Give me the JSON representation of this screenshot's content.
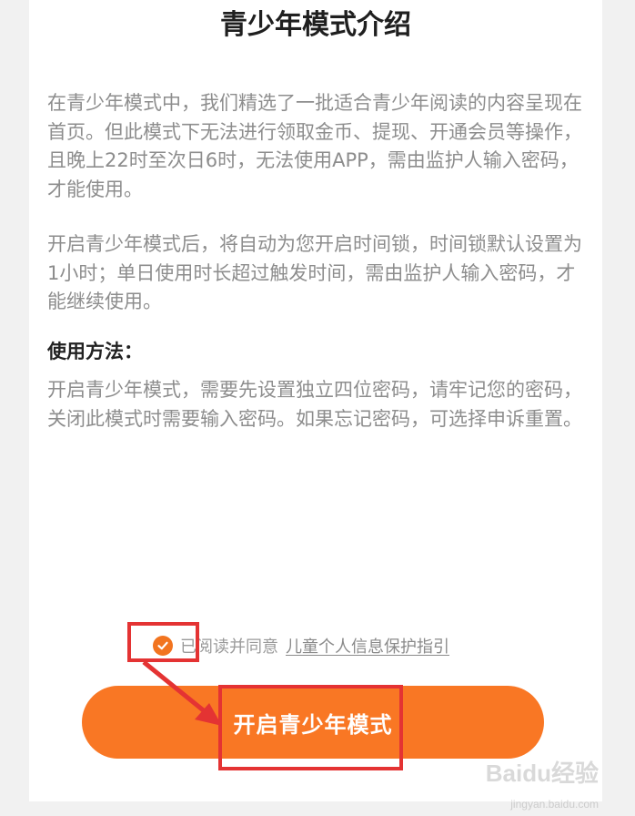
{
  "dialog": {
    "title": "青少年模式介绍",
    "paragraph1": "在青少年模式中，我们精选了一批适合青少年阅读的内容呈现在首页。但此模式下无法进行领取金币、提现、开通会员等操作，且晚上22时至次日6时，无法使用APP，需由监护人输入密码，才能使用。",
    "paragraph2": "开启青少年模式后，将自动为您开启时间锁，时间锁默认设置为1小时；单日使用时长超过触发时间，需由监护人输入密码，才能继续使用。",
    "usage_heading": "使用方法：",
    "paragraph3": "开启青少年模式，需要先设置独立四位密码，请牢记您的密码，关闭此模式时需要输入密码。如果忘记密码，可选择申诉重置。"
  },
  "agreement": {
    "checked": true,
    "prefix": "已阅读并同意",
    "link_label": "儿童个人信息保护指引"
  },
  "cta": {
    "label": "开启青少年模式"
  },
  "watermark": {
    "logo": "Baidu经验",
    "url": "jingyan.baidu.com"
  },
  "colors": {
    "accent": "#f97724",
    "annotation": "#e43333",
    "body_text": "#8d8d8d"
  }
}
